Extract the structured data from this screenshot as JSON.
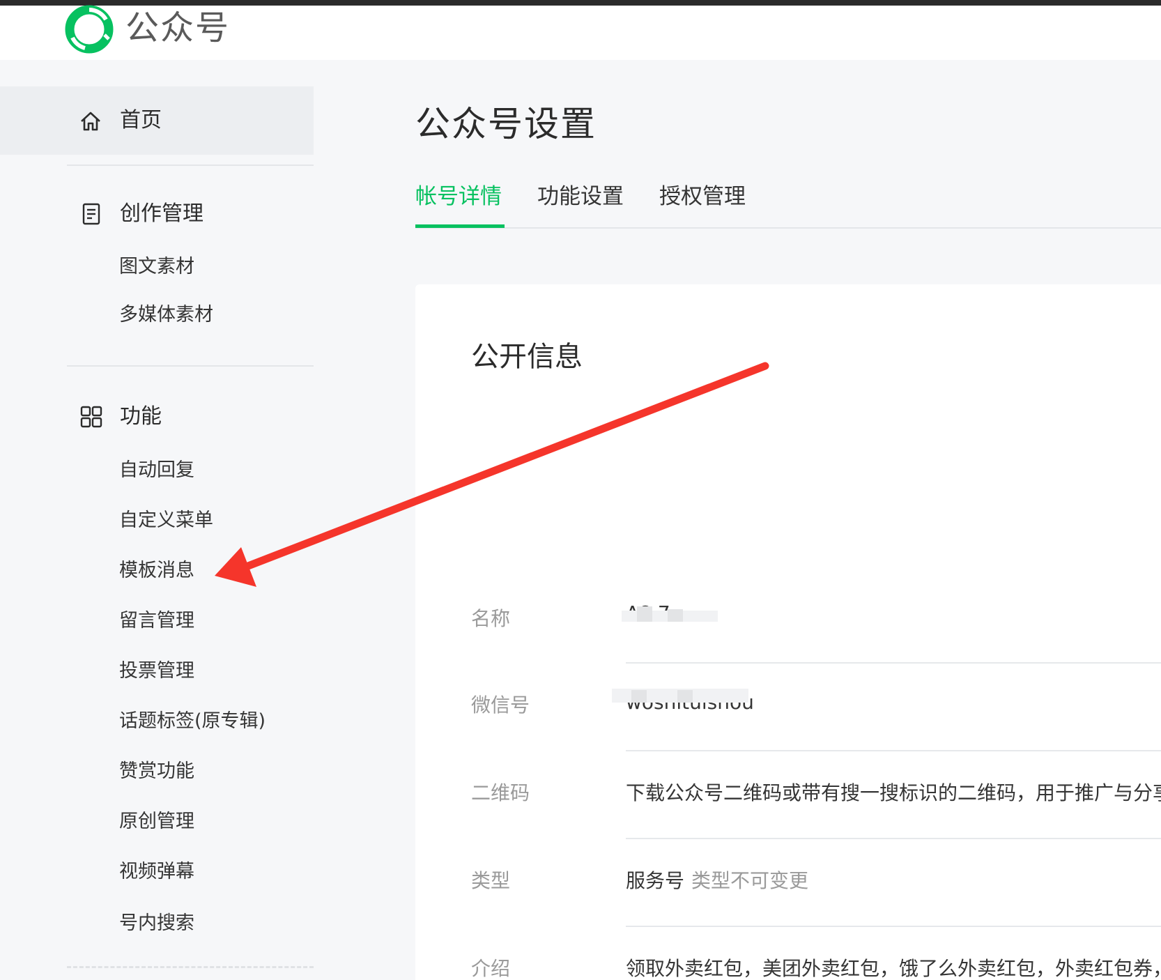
{
  "header": {
    "brand": "公众号"
  },
  "sidebar": {
    "home": {
      "label": "首页",
      "icon": "home-icon"
    },
    "sections": [
      {
        "label": "创作管理",
        "icon": "document-icon",
        "items": [
          "图文素材",
          "多媒体素材"
        ]
      },
      {
        "label": "功能",
        "icon": "grid-icon",
        "items": [
          "自动回复",
          "自定义菜单",
          "模板消息",
          "留言管理",
          "投票管理",
          "话题标签(原专辑)",
          "赞赏功能",
          "原创管理",
          "视频弹幕",
          "号内搜索"
        ]
      }
    ]
  },
  "main": {
    "title": "公众号设置",
    "tabs": [
      {
        "label": "帐号详情",
        "active": true
      },
      {
        "label": "功能设置",
        "active": false
      },
      {
        "label": "授权管理",
        "active": false
      }
    ],
    "card": {
      "title": "公开信息",
      "rows": [
        {
          "label": "名称",
          "value": "A8 7"
        },
        {
          "label": "微信号",
          "value": "woshituishou"
        },
        {
          "label": "二维码",
          "value": "下载公众号二维码或带有搜一搜标识的二维码，用于推广与分享"
        },
        {
          "label": "类型",
          "value": "服务号",
          "note": "类型不可变更"
        },
        {
          "label": "介绍",
          "value": "领取外卖红包，美团外卖红包，饿了么外卖红包，外卖红包券，"
        }
      ]
    }
  },
  "colors": {
    "accent": "#07c160",
    "annotation_arrow": "#f5352b"
  }
}
